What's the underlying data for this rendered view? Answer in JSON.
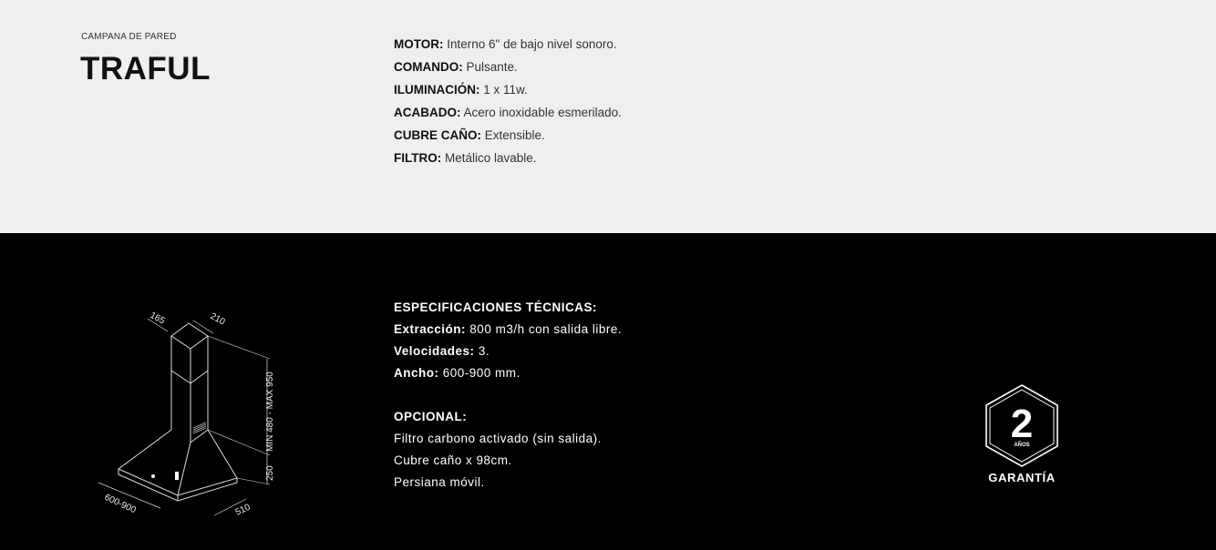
{
  "product": {
    "category": "CAMPANA DE PARED",
    "name": "TRAFUL"
  },
  "features": [
    {
      "label": "MOTOR:",
      "value": "Interno 6\" de bajo nivel sonoro."
    },
    {
      "label": "COMANDO:",
      "value": "Pulsante."
    },
    {
      "label": "ILUMINACIÓN:",
      "value": "1 x 11w."
    },
    {
      "label": "ACABADO:",
      "value": "Acero inoxidable esmerilado."
    },
    {
      "label": "CUBRE CAÑO:",
      "value": "Extensible."
    },
    {
      "label": "FILTRO:",
      "value": "Metálico lavable."
    }
  ],
  "specs": {
    "heading": "ESPECIFICACIONES TÉCNICAS:",
    "items": [
      {
        "label": "Extracción:",
        "value": "800 m3/h con salida libre."
      },
      {
        "label": "Velocidades:",
        "value": "3."
      },
      {
        "label": "Ancho:",
        "value": "600-900 mm."
      }
    ]
  },
  "optional": {
    "heading": "OPCIONAL:",
    "items": [
      "Filtro carbono activado (sin salida).",
      "Cubre caño x 98cm.",
      "Persiana móvil."
    ]
  },
  "dimensions": {
    "depth_top": "165",
    "width_top": "210",
    "height_chimney": "MIN 480 - MAX 950",
    "height_body": "250",
    "width_bottom": "600-900",
    "depth_bottom": "510"
  },
  "warranty": {
    "years": "2",
    "unit": "AÑOS",
    "label": "GARANTÍA"
  },
  "colors": {
    "top_background": "#efefef",
    "bottom_background": "#000000",
    "text_dark": "#111111",
    "text_light": "#ffffff"
  }
}
